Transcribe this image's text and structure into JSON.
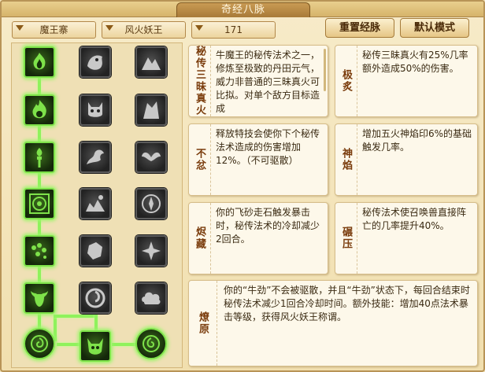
{
  "window": {
    "title": "奇经八脉"
  },
  "filters": {
    "faction": "魔王寨",
    "school": "风火妖王",
    "level": "171"
  },
  "buttons": {
    "reset": "重置经脉",
    "default_mode": "默认模式"
  },
  "skills": [
    {
      "name": "秘传三昧真火",
      "desc": "牛魔王的秘传法术之一，修炼至极致的丹田元气，威力非普通的三昧真火可比拟。对单个敌方目标造成"
    },
    {
      "name": "极炙",
      "desc": "秘传三昧真火有25%几率额外造成50%的伤害。"
    },
    {
      "name": "不忿",
      "desc": "释放特技会使你下个秘传法术造成的伤害增加12%。（不可驱散）"
    },
    {
      "name": "神焰",
      "desc": "增加五火神焰印6%的基础触发几率。"
    },
    {
      "name": "烬藏",
      "desc": "你的飞砂走石触发暴击时，秘传法术的冷却减少2回合。"
    },
    {
      "name": "碾压",
      "desc": "秘传法术使召唤兽直接阵亡的几率提升40%。"
    },
    {
      "name": "燎原",
      "desc": "你的“牛劲”不会被驱散，并且“牛劲”状态下，每回合结束时秘传法术减少1回合冷却时间。额外技能：增加40点法术暴击等级，获得风火妖王称谓。"
    }
  ],
  "tree": {
    "rows": 6,
    "cols": 3,
    "active_column": 0,
    "bottom_nodes": [
      "left-orb",
      "center-demon",
      "right-orb"
    ]
  },
  "colors": {
    "active_glow": "#8ff25c",
    "card_name": "#7a3c0c",
    "panel_bg": "#f1dfae"
  }
}
